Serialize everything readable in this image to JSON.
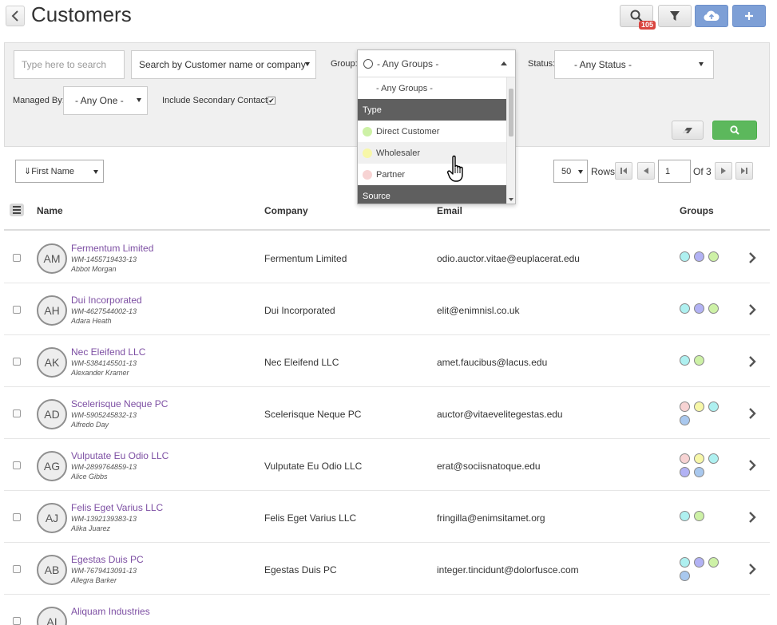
{
  "header": {
    "title": "Customers",
    "badge_count": "105"
  },
  "filters": {
    "search_placeholder": "Type here to search",
    "search_mode": "Search by Customer name or company",
    "group_label": "Group:",
    "group_value": "- Any Groups -",
    "status_label": "Status:",
    "status_value": "- Any Status -",
    "managed_label": "Managed By:",
    "managed_value": "- Any One -",
    "secondary_label": "Include Secondary Contacts:",
    "secondary_checked": "✔"
  },
  "group_dropdown": {
    "items": [
      {
        "kind": "plain",
        "label": "- Any Groups -"
      },
      {
        "kind": "group",
        "label": "Type"
      },
      {
        "kind": "option",
        "label": "Direct Customer",
        "color": "#cdf1a6"
      },
      {
        "kind": "option",
        "label": "Wholesaler",
        "color": "#f7f7a8"
      },
      {
        "kind": "option",
        "label": "Partner",
        "color": "#f7d3d3"
      },
      {
        "kind": "group",
        "label": "Source"
      }
    ]
  },
  "toolbar": {
    "sort_value": "⇓First Name",
    "rows_value": "50",
    "rows_label": "Rows",
    "page_value": "1",
    "of_label": "Of 3"
  },
  "table": {
    "headers": {
      "name": "Name",
      "company": "Company",
      "email": "Email",
      "groups": "Groups"
    },
    "rows": [
      {
        "initials": "AM",
        "name": "Fermentum Limited",
        "id": "WM-1455719433-13",
        "person": "Abbot Morgan",
        "company": "Fermentum Limited",
        "email": "odio.auctor.vitae@euplacerat.edu",
        "groups": [
          "#aef0f0",
          "#b2b2f4",
          "#cdf1a6"
        ]
      },
      {
        "initials": "AH",
        "name": "Dui Incorporated",
        "id": "WM-4627544002-13",
        "person": "Adara Heath",
        "company": "Dui Incorporated",
        "email": "elit@enimnisl.co.uk",
        "groups": [
          "#aef0f0",
          "#b2b2f4",
          "#cdf1a6"
        ]
      },
      {
        "initials": "AK",
        "name": "Nec Eleifend LLC",
        "id": "WM-5384145501-13",
        "person": "Alexander Kramer",
        "company": "Nec Eleifend LLC",
        "email": "amet.faucibus@lacus.edu",
        "groups": [
          "#aef0f0",
          "#cdf1a6"
        ]
      },
      {
        "initials": "AD",
        "name": "Scelerisque Neque PC",
        "id": "WM-5905245832-13",
        "person": "Alfredo Day",
        "company": "Scelerisque Neque PC",
        "email": "auctor@vitaevelitegestas.edu",
        "groups": [
          "#f7d3d3",
          "#f7f7a8",
          "#aef0f0",
          "#a9c8ee"
        ]
      },
      {
        "initials": "AG",
        "name": "Vulputate Eu Odio LLC",
        "id": "WM-2899764859-13",
        "person": "Alice Gibbs",
        "company": "Vulputate Eu Odio LLC",
        "email": "erat@sociisnatoque.edu",
        "groups": [
          "#f7d3d3",
          "#f7f7a8",
          "#aef0f0",
          "#b2b2f4",
          "#a9c8ee"
        ]
      },
      {
        "initials": "AJ",
        "name": "Felis Eget Varius LLC",
        "id": "WM-1392139383-13",
        "person": "Alika Juarez",
        "company": "Felis Eget Varius LLC",
        "email": "fringilla@enimsitamet.org",
        "groups": [
          "#aef0f0",
          "#cdf1a6"
        ]
      },
      {
        "initials": "AB",
        "name": "Egestas Duis PC",
        "id": "WM-7679413091-13",
        "person": "Allegra Barker",
        "company": "Egestas Duis PC",
        "email": "integer.tincidunt@dolorfusce.com",
        "groups": [
          "#aef0f0",
          "#b2b2f4",
          "#cdf1a6",
          "#a9c8ee"
        ]
      },
      {
        "initials": "AI",
        "name": "Aliquam Industries",
        "id": "",
        "person": "",
        "company": "",
        "email": "",
        "groups": []
      }
    ]
  }
}
